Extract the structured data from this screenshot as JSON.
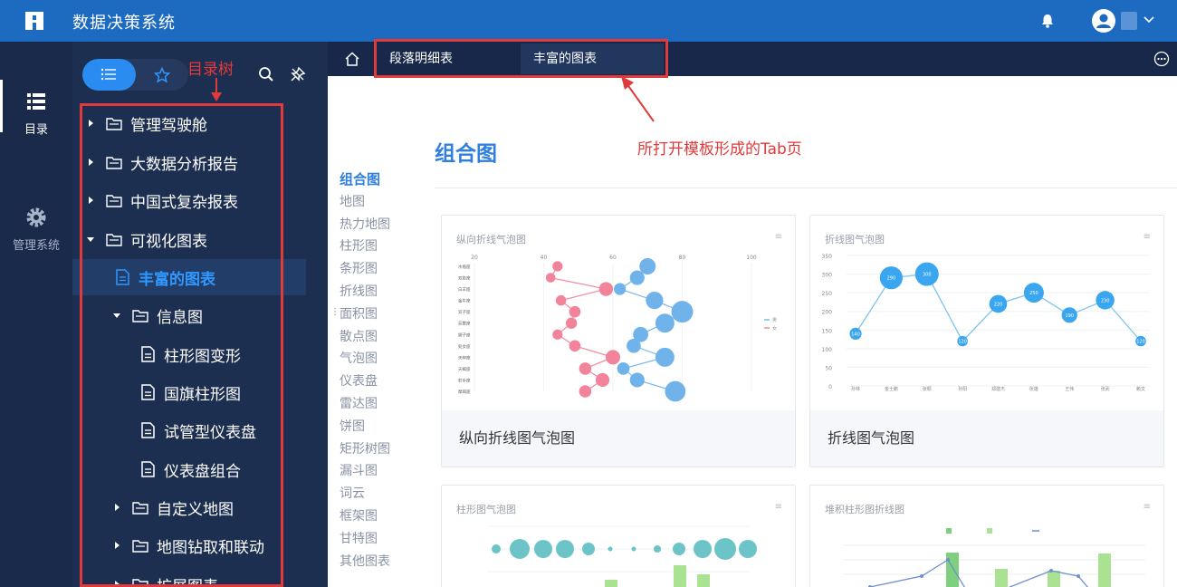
{
  "app": {
    "title": "数据决策系统"
  },
  "leftnav": {
    "items": [
      {
        "label": "目录"
      },
      {
        "label": "管理系统"
      }
    ]
  },
  "directory": {
    "annotation": "目录树",
    "tree": [
      {
        "label": "管理驾驶舱",
        "level": 0,
        "type": "folder",
        "expanded": false
      },
      {
        "label": "大数据分析报告",
        "level": 0,
        "type": "folder",
        "expanded": false
      },
      {
        "label": "中国式复杂报表",
        "level": 0,
        "type": "folder",
        "expanded": false
      },
      {
        "label": "可视化图表",
        "level": 0,
        "type": "folder",
        "expanded": true
      },
      {
        "label": "丰富的图表",
        "level": 1,
        "type": "file",
        "selected": true
      },
      {
        "label": "信息图",
        "level": 1,
        "type": "folder",
        "expanded": true
      },
      {
        "label": "柱形图变形",
        "level": 2,
        "type": "file"
      },
      {
        "label": "国旗柱形图",
        "level": 2,
        "type": "file"
      },
      {
        "label": "试管型仪表盘",
        "level": 2,
        "type": "file"
      },
      {
        "label": "仪表盘组合",
        "level": 2,
        "type": "file"
      },
      {
        "label": "自定义地图",
        "level": 1,
        "type": "folder",
        "expanded": false
      },
      {
        "label": "地图钻取和联动",
        "level": 1,
        "type": "folder",
        "expanded": false
      },
      {
        "label": "扩展图表",
        "level": 1,
        "type": "folder",
        "expanded": false
      }
    ]
  },
  "tabs": {
    "annotation": "所打开模板形成的Tab页",
    "items": [
      {
        "label": "段落明细表"
      },
      {
        "label": "丰富的图表",
        "active": true
      }
    ]
  },
  "content": {
    "section_title": "组合图",
    "categories": [
      "组合图",
      "地图",
      "热力地图",
      "柱形图",
      "条形图",
      "折线图",
      "面积图",
      "散点图",
      "气泡图",
      "仪表盘",
      "雷达图",
      "饼图",
      "矩形树图",
      "漏斗图",
      "词云",
      "框架图",
      "甘特图",
      "其他图表"
    ],
    "active_category": "组合图",
    "cards": [
      {
        "mini_title": "纵向折线气泡图",
        "caption": "纵向折线图气泡图"
      },
      {
        "mini_title": "折线图气泡图",
        "caption": "折线图气泡图"
      },
      {
        "mini_title": "柱形图气泡图",
        "caption": ""
      },
      {
        "mini_title": "堆积柱形图折线图",
        "caption": ""
      }
    ]
  },
  "colors": {
    "topbar": "#1d6ac1",
    "nav": "#192a4a",
    "panel": "#1d2f50",
    "accent": "#2f98ff",
    "annotation": "#e23a3a"
  },
  "chart_data": [
    {
      "type": "line",
      "title": "折线图气泡图",
      "categories": [
        "孙林",
        "金士鹏",
        "张颖",
        "孙阳",
        "郑建杰",
        "张雄",
        "王伟",
        "张武",
        "赖文"
      ],
      "values": [
        140,
        290,
        300,
        120,
        220,
        250,
        190,
        230,
        120
      ],
      "labels": [
        "140",
        "290",
        "300",
        "120",
        "220",
        "250",
        "190",
        "230",
        "120"
      ],
      "ylim": [
        0,
        350
      ],
      "yticks": [
        "0",
        "50",
        "100",
        "150",
        "200",
        "250",
        "300",
        "350"
      ]
    },
    {
      "type": "line",
      "title": "纵向折线气泡图",
      "orientation": "vertical",
      "xticks": [
        "20",
        "40",
        "60",
        "80",
        "100"
      ],
      "xlim": [
        20,
        100
      ],
      "categories": [
        "水瓶座",
        "双鱼座",
        "白羊座",
        "金牛座",
        "双子座",
        "巨蟹座",
        "狮子座",
        "处女座",
        "天秤座",
        "天蝎座",
        "射手座",
        "摩羯座"
      ],
      "series": [
        {
          "name": "男",
          "values": [
            70,
            67,
            62,
            72,
            80,
            75,
            68,
            66,
            75,
            63,
            67,
            78
          ]
        },
        {
          "name": "女",
          "values": [
            44,
            42,
            58,
            45,
            49,
            48,
            44,
            49,
            60,
            52,
            57,
            52
          ]
        }
      ]
    }
  ]
}
